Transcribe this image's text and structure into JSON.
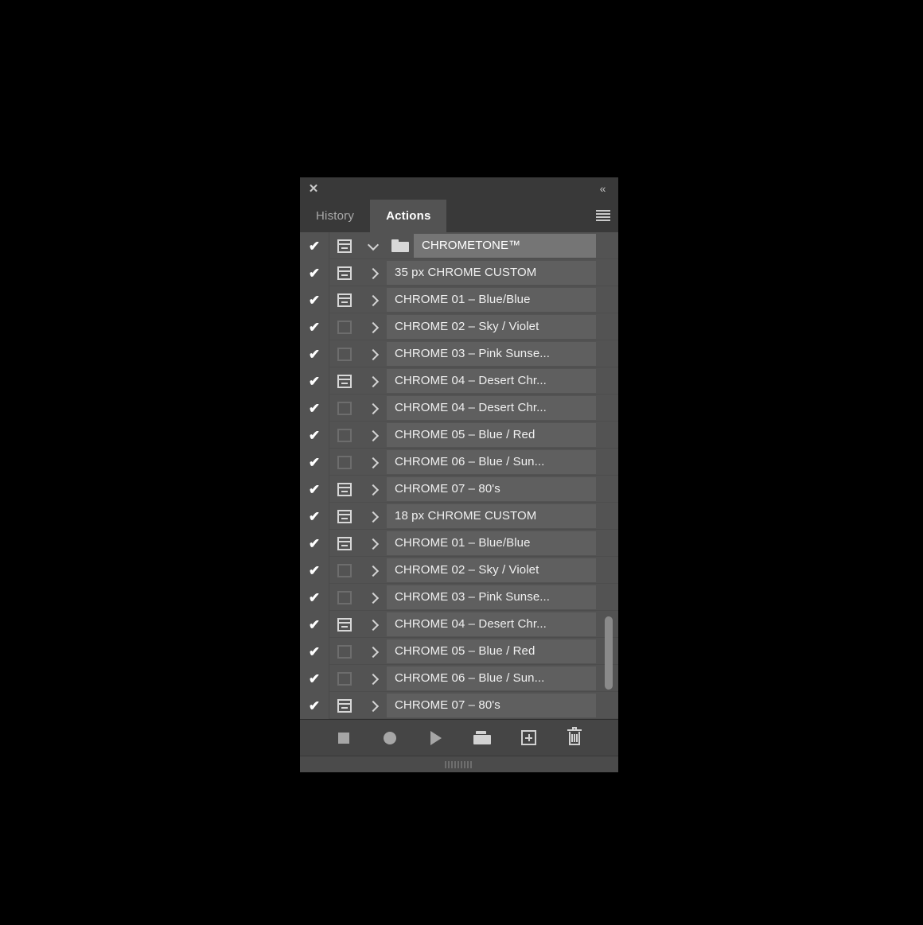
{
  "titlebar": {
    "close_label": "✕",
    "collapse_label": "«"
  },
  "tabs": [
    {
      "label": "History",
      "active": false
    },
    {
      "label": "Actions",
      "active": true
    }
  ],
  "panel_menu": {
    "name": "panel-menu-icon"
  },
  "colors": {
    "panel_bg": "#535353",
    "chrome_bg": "#393939",
    "row_bg": "#5f5f5f",
    "row_selected_bg": "#757575",
    "toolbar_bg": "#454545",
    "icon": "#d2d2d2",
    "text": "#f0f0f0",
    "scroll_thumb": "#8a8a8a"
  },
  "rows": [
    {
      "label": "CHROMETONE™",
      "checked": true,
      "dialog": "on",
      "arrow": "down",
      "folder": true,
      "selected": true,
      "indent": false
    },
    {
      "label": "35 px CHROME CUSTOM",
      "checked": true,
      "dialog": "on",
      "arrow": "right",
      "folder": false,
      "selected": false,
      "indent": true
    },
    {
      "label": "CHROME 01 – Blue/Blue",
      "checked": true,
      "dialog": "on",
      "arrow": "right",
      "folder": false,
      "selected": false,
      "indent": true
    },
    {
      "label": "CHROME 02 – Sky / Violet",
      "checked": true,
      "dialog": "off",
      "arrow": "right",
      "folder": false,
      "selected": false,
      "indent": true
    },
    {
      "label": "CHROME 03 – Pink Sunse...",
      "checked": true,
      "dialog": "off",
      "arrow": "right",
      "folder": false,
      "selected": false,
      "indent": true
    },
    {
      "label": "CHROME 04 – Desert Chr...",
      "checked": true,
      "dialog": "on",
      "arrow": "right",
      "folder": false,
      "selected": false,
      "indent": true
    },
    {
      "label": "CHROME 04 – Desert Chr...",
      "checked": true,
      "dialog": "off",
      "arrow": "right",
      "folder": false,
      "selected": false,
      "indent": true
    },
    {
      "label": "CHROME 05 – Blue / Red",
      "checked": true,
      "dialog": "off",
      "arrow": "right",
      "folder": false,
      "selected": false,
      "indent": true
    },
    {
      "label": "CHROME 06 – Blue / Sun...",
      "checked": true,
      "dialog": "off",
      "arrow": "right",
      "folder": false,
      "selected": false,
      "indent": true
    },
    {
      "label": "CHROME 07 – 80's",
      "checked": true,
      "dialog": "on",
      "arrow": "right",
      "folder": false,
      "selected": false,
      "indent": true
    },
    {
      "label": "18 px CHROME CUSTOM",
      "checked": true,
      "dialog": "on",
      "arrow": "right",
      "folder": false,
      "selected": false,
      "indent": true
    },
    {
      "label": "CHROME 01 – Blue/Blue",
      "checked": true,
      "dialog": "on",
      "arrow": "right",
      "folder": false,
      "selected": false,
      "indent": true
    },
    {
      "label": "CHROME 02 – Sky / Violet",
      "checked": true,
      "dialog": "off",
      "arrow": "right",
      "folder": false,
      "selected": false,
      "indent": true
    },
    {
      "label": "CHROME 03 – Pink Sunse...",
      "checked": true,
      "dialog": "off",
      "arrow": "right",
      "folder": false,
      "selected": false,
      "indent": true
    },
    {
      "label": "CHROME 04 – Desert Chr...",
      "checked": true,
      "dialog": "on",
      "arrow": "right",
      "folder": false,
      "selected": false,
      "indent": true
    },
    {
      "label": "CHROME 05 – Blue / Red",
      "checked": true,
      "dialog": "off",
      "arrow": "right",
      "folder": false,
      "selected": false,
      "indent": true
    },
    {
      "label": "CHROME 06 – Blue / Sun...",
      "checked": true,
      "dialog": "off",
      "arrow": "right",
      "folder": false,
      "selected": false,
      "indent": true
    },
    {
      "label": "CHROME 07 – 80's",
      "checked": true,
      "dialog": "on",
      "arrow": "right",
      "folder": false,
      "selected": false,
      "indent": true
    }
  ],
  "check_glyph": "✔",
  "scrollbar": {
    "thumb_top_pct": 79,
    "thumb_height_pct": 15
  },
  "toolbar": [
    {
      "name": "stop-button",
      "icon": "stop-icon"
    },
    {
      "name": "record-button",
      "icon": "record-icon"
    },
    {
      "name": "play-button",
      "icon": "play-icon"
    },
    {
      "name": "new-set-button",
      "icon": "folder-icon"
    },
    {
      "name": "new-action-button",
      "icon": "plus-square-icon"
    },
    {
      "name": "delete-button",
      "icon": "trash-icon"
    }
  ]
}
